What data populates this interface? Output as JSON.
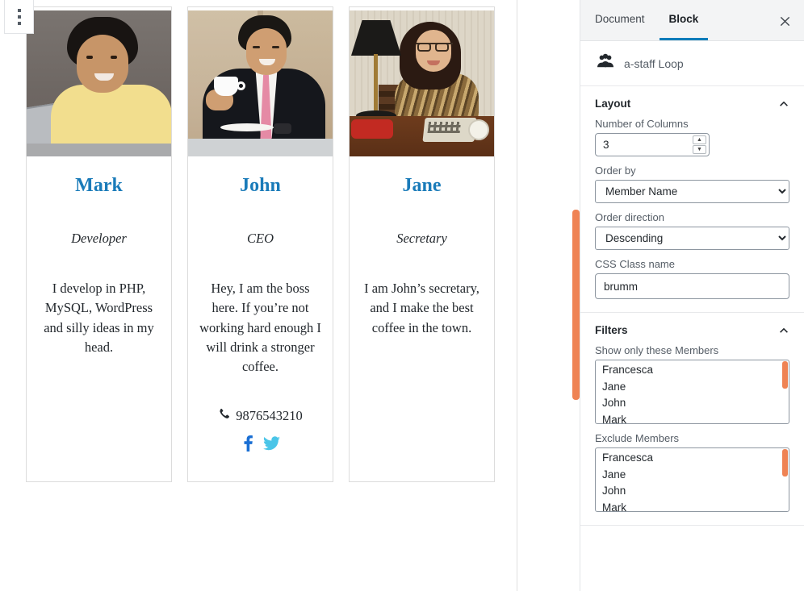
{
  "editor": {
    "block_handle_icon": "vertical-dots-icon",
    "cards": [
      {
        "name": "Mark",
        "role": "Developer",
        "bio": "I develop in PHP, MySQL, WordPress and silly ideas in my head.",
        "phone": "",
        "photo_alt": "young-man-at-laptop-photo",
        "socials": []
      },
      {
        "name": "John",
        "role": "CEO",
        "bio": "Hey, I am the boss here. If you’re not working hard enough I will drink a stronger coffee.",
        "phone": "9876543210",
        "photo_alt": "businessman-with-coffee-photo",
        "socials": [
          "facebook-icon",
          "twitter-icon"
        ]
      },
      {
        "name": "Jane",
        "role": "Secretary",
        "bio": "I am John’s secretary, and I make the best coffee in the town.",
        "phone": "",
        "photo_alt": "woman-at-desk-photo",
        "socials": []
      }
    ]
  },
  "sidebar": {
    "tabs": [
      {
        "label": "Document",
        "active": false
      },
      {
        "label": "Block",
        "active": true
      }
    ],
    "close_label": "✕",
    "block": {
      "icon": "group-people-icon",
      "title": "a-staff Loop"
    },
    "layout_panel": {
      "title": "Layout",
      "collapse_icon": "chevron-up-icon",
      "columns": {
        "label": "Number of Columns",
        "value": "3"
      },
      "order_by": {
        "label": "Order by",
        "value": "Member Name",
        "options": [
          "Member Name"
        ]
      },
      "order_direction": {
        "label": "Order direction",
        "value": "Descending",
        "options": [
          "Descending"
        ]
      },
      "css_class": {
        "label": "CSS Class name",
        "value": "brumm",
        "placeholder": ""
      }
    },
    "filters_panel": {
      "title": "Filters",
      "collapse_icon": "chevron-up-icon",
      "show_only": {
        "label": "Show only these Members",
        "options": [
          "Francesca",
          "Jane",
          "John",
          "Mark"
        ]
      },
      "exclude": {
        "label": "Exclude Members",
        "options": [
          "Francesca",
          "Jane",
          "John",
          "Mark"
        ]
      }
    }
  },
  "colors": {
    "accent_blue": "#007cba",
    "name_blue": "#1a7bb9",
    "scrollbar_orange": "#ef8354",
    "facebook": "#1a6fd4",
    "twitter": "#4ac5e8"
  }
}
